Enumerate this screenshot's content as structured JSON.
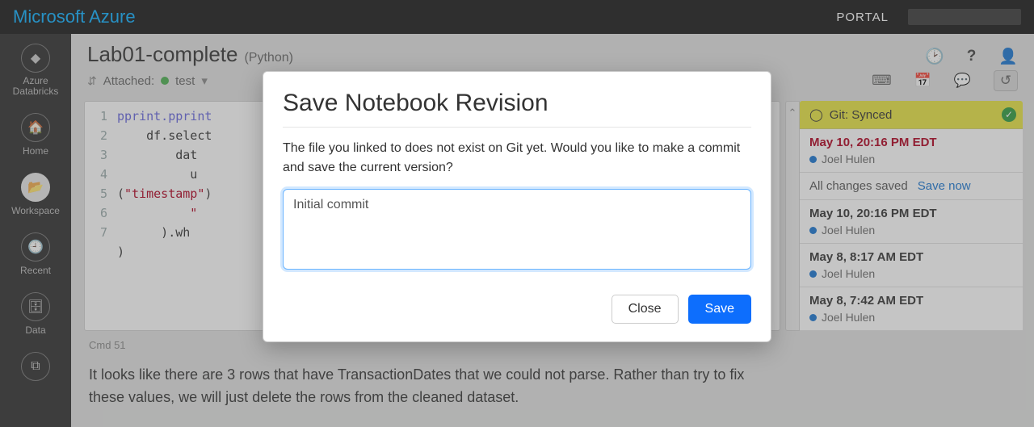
{
  "header": {
    "brand": "Microsoft Azure",
    "portal": "PORTAL"
  },
  "left_rail": {
    "items": [
      {
        "label": "Azure\nDatabricks"
      },
      {
        "label": "Home"
      },
      {
        "label": "Workspace"
      },
      {
        "label": "Recent"
      },
      {
        "label": "Data"
      }
    ]
  },
  "notebook": {
    "title": "Lab01-complete",
    "language": "(Python)",
    "attached_label": "Attached:",
    "cluster_name": "test",
    "cmd_label_prefix": "Cmd",
    "cmd_number": "51",
    "code": {
      "lines": [
        "1",
        "2",
        "3",
        "4",
        "5",
        "6",
        "7"
      ],
      "l1a": "pprint.pprint",
      "l2a": "    df.select",
      "l3a": "        dat",
      "l4a": "          u",
      "l5a": "(",
      "l5b": "\"timestamp\"",
      "l5c": ")",
      "l6a": "          \"",
      "l7a": "      ).wh",
      "l8a": ")"
    },
    "markdown_text": "It looks like there are 3 rows that have TransactionDates that we could not parse. Rather than try to fix these values, we will just delete the rows from the cleaned dataset."
  },
  "revisions": {
    "git_status": "Git: Synced",
    "save_status": "All changes saved",
    "save_now": "Save now",
    "items": [
      {
        "date": "May 10, 20:16 PM EDT",
        "user": "Joel Hulen",
        "current": true
      },
      {
        "date": "May 10, 20:16 PM EDT",
        "user": "Joel Hulen",
        "current": false
      },
      {
        "date": "May 8, 8:17 AM EDT",
        "user": "Joel Hulen",
        "current": false
      },
      {
        "date": "May 8, 7:42 AM EDT",
        "user": "Joel Hulen",
        "current": false
      }
    ]
  },
  "modal": {
    "title": "Save Notebook Revision",
    "message": "The file you linked to does not exist on Git yet. Would you like to make a commit and save the current version?",
    "input_value": "Initial commit",
    "close": "Close",
    "save": "Save"
  }
}
